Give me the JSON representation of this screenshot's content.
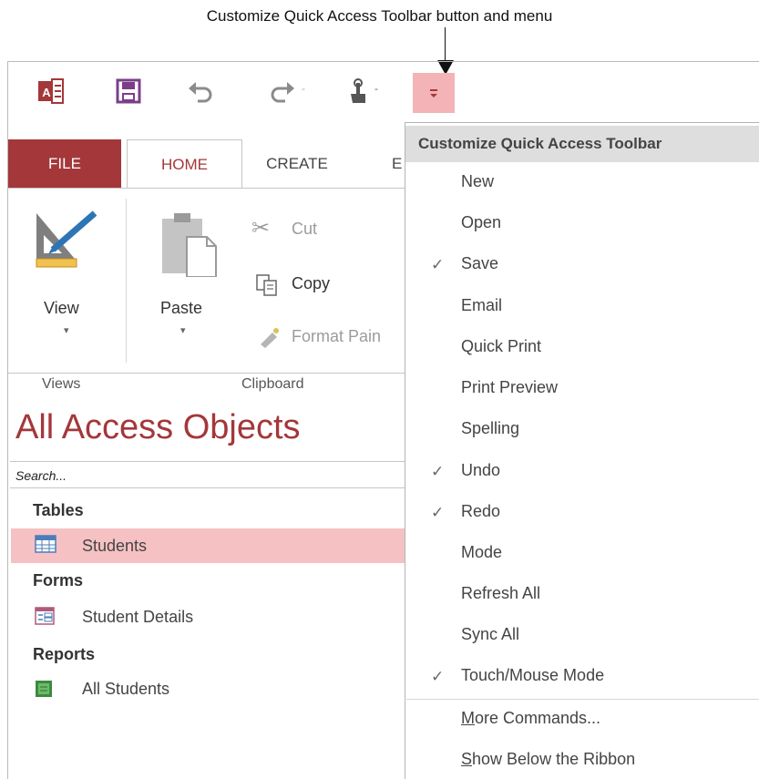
{
  "callout": {
    "text": "Customize Quick Access Toolbar button and menu"
  },
  "qat": {
    "app_icon": "access-logo-icon",
    "items": [
      "save-icon",
      "undo-icon",
      "redo-icon",
      "touch-mouse-mode-icon",
      "customize-toolbar-icon"
    ],
    "dropdown_glyph": "-"
  },
  "tabs": [
    "FILE",
    "HOME",
    "CREATE",
    "E"
  ],
  "ribbon": {
    "views": {
      "button": "View",
      "group": "Views"
    },
    "clipboard": {
      "paste": "Paste",
      "cut": "Cut",
      "copy": "Copy",
      "format_painter": "Format Pain",
      "group": "Clipboard"
    }
  },
  "nav": {
    "title": "All Access Objects",
    "search_placeholder": "Search...",
    "sections": [
      {
        "label": "Tables",
        "items": [
          "Students"
        ]
      },
      {
        "label": "Forms",
        "items": [
          "Student Details"
        ]
      },
      {
        "label": "Reports",
        "items": [
          "All Students"
        ]
      }
    ]
  },
  "menu": {
    "header": "Customize Quick Access Toolbar",
    "items": [
      {
        "label": "New",
        "checked": false
      },
      {
        "label": "Open",
        "checked": false
      },
      {
        "label": "Save",
        "checked": true
      },
      {
        "label": "Email",
        "checked": false
      },
      {
        "label": "Quick Print",
        "checked": false
      },
      {
        "label": "Print Preview",
        "checked": false
      },
      {
        "label": "Spelling",
        "checked": false
      },
      {
        "label": "Undo",
        "checked": true
      },
      {
        "label": "Redo",
        "checked": true
      },
      {
        "label": "Mode",
        "checked": false
      },
      {
        "label": "Refresh All",
        "checked": false
      },
      {
        "label": "Sync All",
        "checked": false
      },
      {
        "label": "Touch/Mouse Mode",
        "checked": true
      }
    ],
    "more_commands": {
      "underline": "M",
      "rest": "ore Commands..."
    },
    "show_below": {
      "underline": "S",
      "rest": "how Below the Ribbon"
    },
    "check_glyph": "✓"
  },
  "colors": {
    "accent": "#a4373a",
    "selected_row": "#f6c1c3",
    "customize_button": "#f4b3b6",
    "menu_header": "#dedede"
  }
}
